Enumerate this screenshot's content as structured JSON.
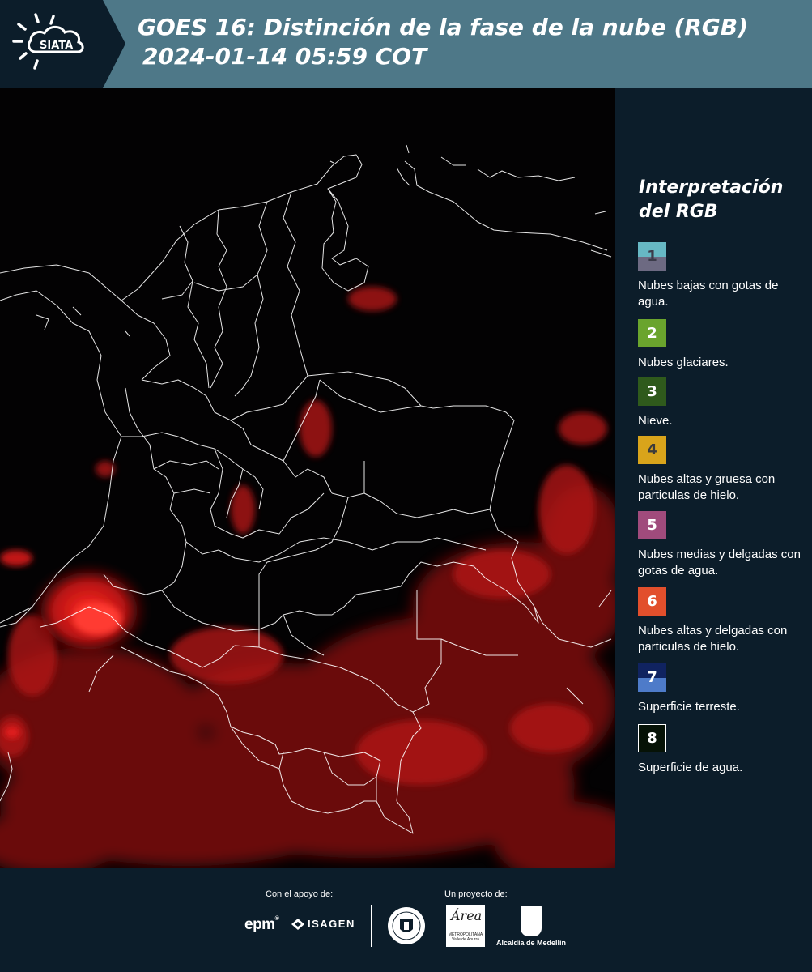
{
  "header": {
    "logo_text": "SIATA",
    "title_line1": "GOES 16: Distinción de la fase de la nube (RGB)",
    "title_line2": "2024-01-14 05:59 COT",
    "background_color": "#4e7888"
  },
  "legend": {
    "title": "Interpretación del RGB",
    "items": [
      {
        "number": "1",
        "label": "Nubes bajas con gotas de agua.",
        "color_top": "#67b8c4",
        "color_bottom": "#6d6a82",
        "number_color": "#3b3b4a"
      },
      {
        "number": "2",
        "label": "Nubes glaciares.",
        "color_top": "#6aa42d",
        "color_bottom": "#6aa42d",
        "number_color": "#ffffff"
      },
      {
        "number": "3",
        "label": "Nieve.",
        "color_top": "#2f5a1c",
        "color_bottom": "#2f5a1c",
        "number_color": "#ffffff"
      },
      {
        "number": "4",
        "label": "Nubes altas y gruesa con particulas de hielo.",
        "color_top": "#d9a41b",
        "color_bottom": "#d9a41b",
        "number_color": "#3b3b3b"
      },
      {
        "number": "5",
        "label": "Nubes medias y delgadas con gotas de agua.",
        "color_top": "#a04b7c",
        "color_bottom": "#a04b7c",
        "number_color": "#ffffff"
      },
      {
        "number": "6",
        "label": "Nubes altas y delgadas con particulas de hielo.",
        "color_top": "#e24f2c",
        "color_bottom": "#e24f2c",
        "number_color": "#ffffff"
      },
      {
        "number": "7",
        "label": "Superficie terreste.",
        "color_top": "#102360",
        "color_bottom": "#4e7bc9",
        "number_color": "#ffffff"
      },
      {
        "number": "8",
        "label": "Superficie de agua.",
        "color_top": "#061206",
        "color_bottom": "#061206",
        "number_color": "#ffffff"
      }
    ]
  },
  "footer": {
    "support_label": "Con el apoyo de:",
    "project_label": "Un proyecto de:",
    "sponsor_1": "epm",
    "sponsor_2": "ISAGEN",
    "partner_1": "Área",
    "partner_1_sub": "METROPOLITANA Valle de Aburrá",
    "partner_2": "Alcaldía de Medellín"
  },
  "map": {
    "image": "goes16-cloud-phase-rgb-colombia",
    "boundary_color": "#ffffff",
    "cloud_color": "#d81818"
  }
}
